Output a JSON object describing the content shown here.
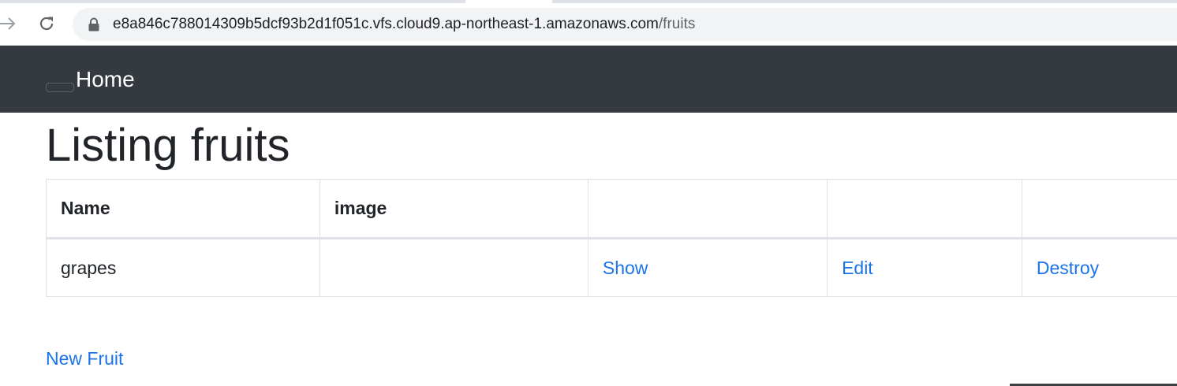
{
  "browser": {
    "url_host": "e8a846c788014309b5dcf93b2d1f051c.vfs.cloud9.ap-northeast-1.amazonaws.com",
    "url_path": "/fruits",
    "icons": {
      "forward": "arrow-right-icon",
      "reload": "reload-icon",
      "lock": "lock-icon"
    }
  },
  "navbar": {
    "brand": "Home",
    "background": "#343a40"
  },
  "page": {
    "title": "Listing fruits",
    "new_link": "New Fruit",
    "link_color": "#1a73e8"
  },
  "table": {
    "headers": [
      "Name",
      "image",
      "",
      "",
      ""
    ],
    "rows": [
      {
        "name": "grapes",
        "image": "",
        "show": "Show",
        "edit": "Edit",
        "destroy": "Destroy"
      }
    ]
  }
}
